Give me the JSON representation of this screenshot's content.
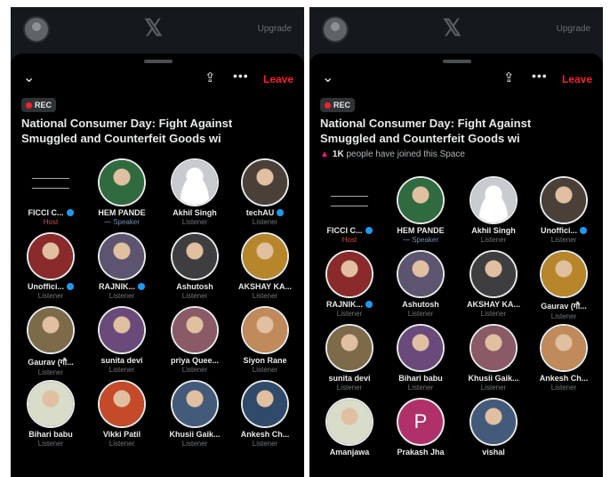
{
  "topbar": {
    "upgrade_label": "Upgrade"
  },
  "space": {
    "leave_label": "Leave",
    "rec_label": "REC",
    "title_line1": "National Consumer Day: Fight Against",
    "title_line2": "Smuggled and Counterfeit Goods wi",
    "joined_count": "1K",
    "joined_text": "people have joined this Space"
  },
  "left_panel": {
    "participants": [
      {
        "name": "FICCI C...",
        "role": "Host",
        "verified": true
      },
      {
        "name": "HEM PANDE",
        "role": "Speaker",
        "verified": false
      },
      {
        "name": "Akhil Singh",
        "role": "Listener",
        "verified": false
      },
      {
        "name": "techAU",
        "role": "Listener",
        "verified": true
      },
      {
        "name": "Unoffici...",
        "role": "Listener",
        "verified": true
      },
      {
        "name": "RAJNIK...",
        "role": "Listener",
        "verified": true
      },
      {
        "name": "Ashutosh",
        "role": "Listener",
        "verified": false
      },
      {
        "name": "AKSHAY KA...",
        "role": "Listener",
        "verified": false
      },
      {
        "name": "Gaurav (गौ...",
        "role": "Listener",
        "verified": false
      },
      {
        "name": "sunita devi",
        "role": "Listener",
        "verified": false
      },
      {
        "name": "priya Quee...",
        "role": "Listener",
        "verified": false
      },
      {
        "name": "Siyon Rane",
        "role": "Listener",
        "verified": false
      },
      {
        "name": "Bihari babu",
        "role": "Listener",
        "verified": false
      },
      {
        "name": "Vikki Patil",
        "role": "Listener",
        "verified": false
      },
      {
        "name": "Khusii Gaik...",
        "role": "Listener",
        "verified": false
      },
      {
        "name": "Ankesh Ch...",
        "role": "Listener",
        "verified": false
      }
    ]
  },
  "right_panel": {
    "participants": [
      {
        "name": "FICCI C...",
        "role": "Host",
        "verified": true
      },
      {
        "name": "HEM PANDE",
        "role": "Speaker",
        "verified": false
      },
      {
        "name": "Akhil Singh",
        "role": "Listener",
        "verified": false
      },
      {
        "name": "Unoffici...",
        "role": "Listener",
        "verified": true
      },
      {
        "name": "RAJNIK...",
        "role": "Listener",
        "verified": true
      },
      {
        "name": "Ashutosh",
        "role": "Listener",
        "verified": false
      },
      {
        "name": "AKSHAY KA...",
        "role": "Listener",
        "verified": false
      },
      {
        "name": "Gaurav (गौ...",
        "role": "Listener",
        "verified": false
      },
      {
        "name": "sunita devi",
        "role": "Listener",
        "verified": false
      },
      {
        "name": "Bihari babu",
        "role": "Listener",
        "verified": false
      },
      {
        "name": "Khusii Gaik...",
        "role": "Listener",
        "verified": false
      },
      {
        "name": "Ankesh Ch...",
        "role": "Listener",
        "verified": false
      },
      {
        "name": "Amanjawa",
        "role": "",
        "verified": false
      },
      {
        "name": "Prakash Jha",
        "role": "",
        "verified": false
      },
      {
        "name": "vishal",
        "role": "",
        "verified": false
      }
    ]
  },
  "avatar_colors": [
    "#5a5f66",
    "#2f6b3e",
    "#c8ccd1",
    "#4a4038",
    "#8a2a2a",
    "#5d5470",
    "#3e3e40",
    "#b8862a",
    "#7d6a48",
    "#6a4a7a",
    "#8a5a66",
    "#c08a5a",
    "#d8dcc8",
    "#c44a2a",
    "#445a7a",
    "#2f4a6a",
    "#8a8a70",
    "#b0306a",
    "#3a6a3a"
  ],
  "prakash_initial": "P",
  "prakash_color": "#b0306a"
}
